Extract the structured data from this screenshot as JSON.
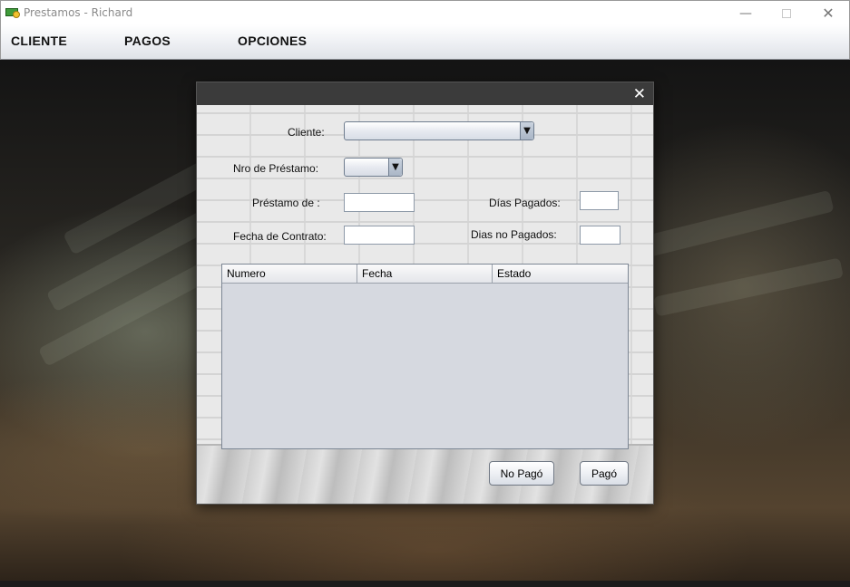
{
  "window": {
    "title": "Prestamos - Richard"
  },
  "menu": {
    "cliente": "CLIENTE",
    "pagos": "PAGOS",
    "opciones": "OPCIONES"
  },
  "dialog": {
    "close_glyph": "✕",
    "labels": {
      "cliente": "Cliente:",
      "nro_prestamo": "Nro de Préstamo:",
      "prestamo_de": "Préstamo de :",
      "fecha_contrato": "Fecha de Contrato:",
      "dias_pagados": "Días Pagados:",
      "dias_no_pagados": "Dias no Pagados:"
    },
    "values": {
      "cliente": "",
      "nro_prestamo": "",
      "prestamo_de": "",
      "fecha_contrato": "",
      "dias_pagados": "",
      "dias_no_pagados": ""
    },
    "table": {
      "columns": [
        "Numero",
        "Fecha",
        "Estado"
      ],
      "rows": []
    },
    "buttons": {
      "no_pago": "No Pagó",
      "pago": "Pagó"
    }
  },
  "icons": {
    "app": "money-icon",
    "minimize": "minimize-icon",
    "maximize": "maximize-icon",
    "close": "close-icon",
    "dropdown": "chevron-down-icon"
  }
}
